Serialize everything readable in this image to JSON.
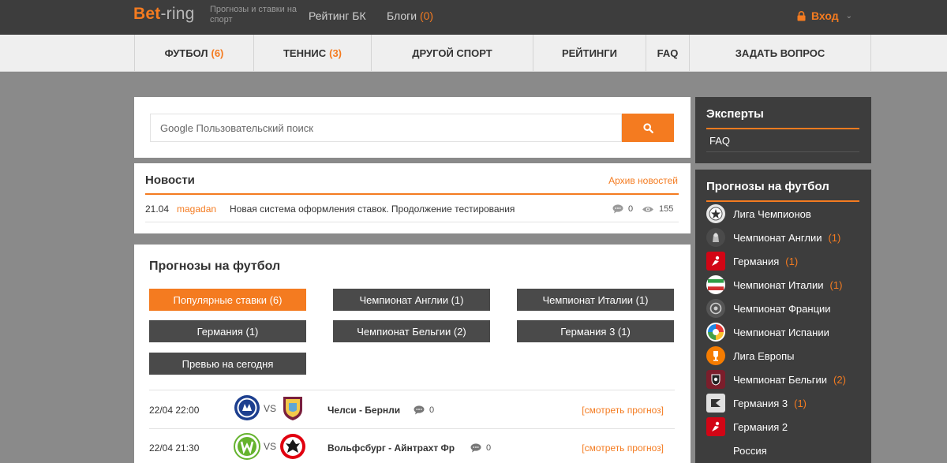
{
  "header": {
    "logo_part1": "Bet",
    "logo_part2": "-ring",
    "tagline": "Прогнозы и ставки на спорт",
    "rating_link": "Рейтинг БК",
    "blogs_link": "Блоги",
    "blogs_count": "(0)",
    "login": "Вход"
  },
  "nav": {
    "football": "ФУТБОЛ",
    "football_count": "(6)",
    "tennis": "ТЕННИС",
    "tennis_count": "(3)",
    "other": "ДРУГОЙ СПОРТ",
    "ratings": "РЕЙТИНГИ",
    "faq": "FAQ",
    "ask": "ЗАДАТЬ ВОПРОС"
  },
  "search": {
    "placeholder": "Google Пользовательский поиск"
  },
  "news": {
    "title": "Новости",
    "archive": "Архив новостей",
    "items": [
      {
        "date": "21.04",
        "author": "magadan",
        "text": "Новая система оформления ставок. Продолжение тестирования",
        "comments": "0",
        "views": "155"
      }
    ]
  },
  "football": {
    "title": "Прогнозы на футбол",
    "buttons": [
      "Популярные ставки (6)",
      "Чемпионат Англии (1)",
      "Чемпионат Италии (1)",
      "Германия (1)",
      "Чемпионат Бельгии (2)",
      "Германия 3 (1)",
      "Превью на сегодня"
    ],
    "vs_label": "VS",
    "forecast_link": "[смотреть прогноз]",
    "matches": [
      {
        "datetime": "22/04 22:00",
        "teams": "Челси - Бернли",
        "comments": "0"
      },
      {
        "datetime": "22/04 21:30",
        "teams": "Вольфсбург - Айнтрахт Фр",
        "comments": "0"
      }
    ]
  },
  "sidebar": {
    "experts_title": "Эксперты",
    "experts_faq": "FAQ",
    "forecasts_title": "Прогнозы на футбол",
    "leagues": [
      {
        "name": "Лига Чемпионов",
        "count": ""
      },
      {
        "name": "Чемпионат Англии",
        "count": "(1)"
      },
      {
        "name": "Германия",
        "count": "(1)"
      },
      {
        "name": "Чемпионат Италии",
        "count": "(1)"
      },
      {
        "name": "Чемпионат Франции",
        "count": ""
      },
      {
        "name": "Чемпионат Испании",
        "count": ""
      },
      {
        "name": "Лига Европы",
        "count": ""
      },
      {
        "name": "Чемпионат Бельгии",
        "count": "(2)"
      },
      {
        "name": "Германия 3",
        "count": "(1)"
      },
      {
        "name": "Германия 2",
        "count": ""
      },
      {
        "name": "Россия",
        "count": ""
      }
    ]
  },
  "colors": {
    "accent": "#f47b20",
    "dark": "#3d3d3d",
    "button": "#4a4a4a"
  }
}
